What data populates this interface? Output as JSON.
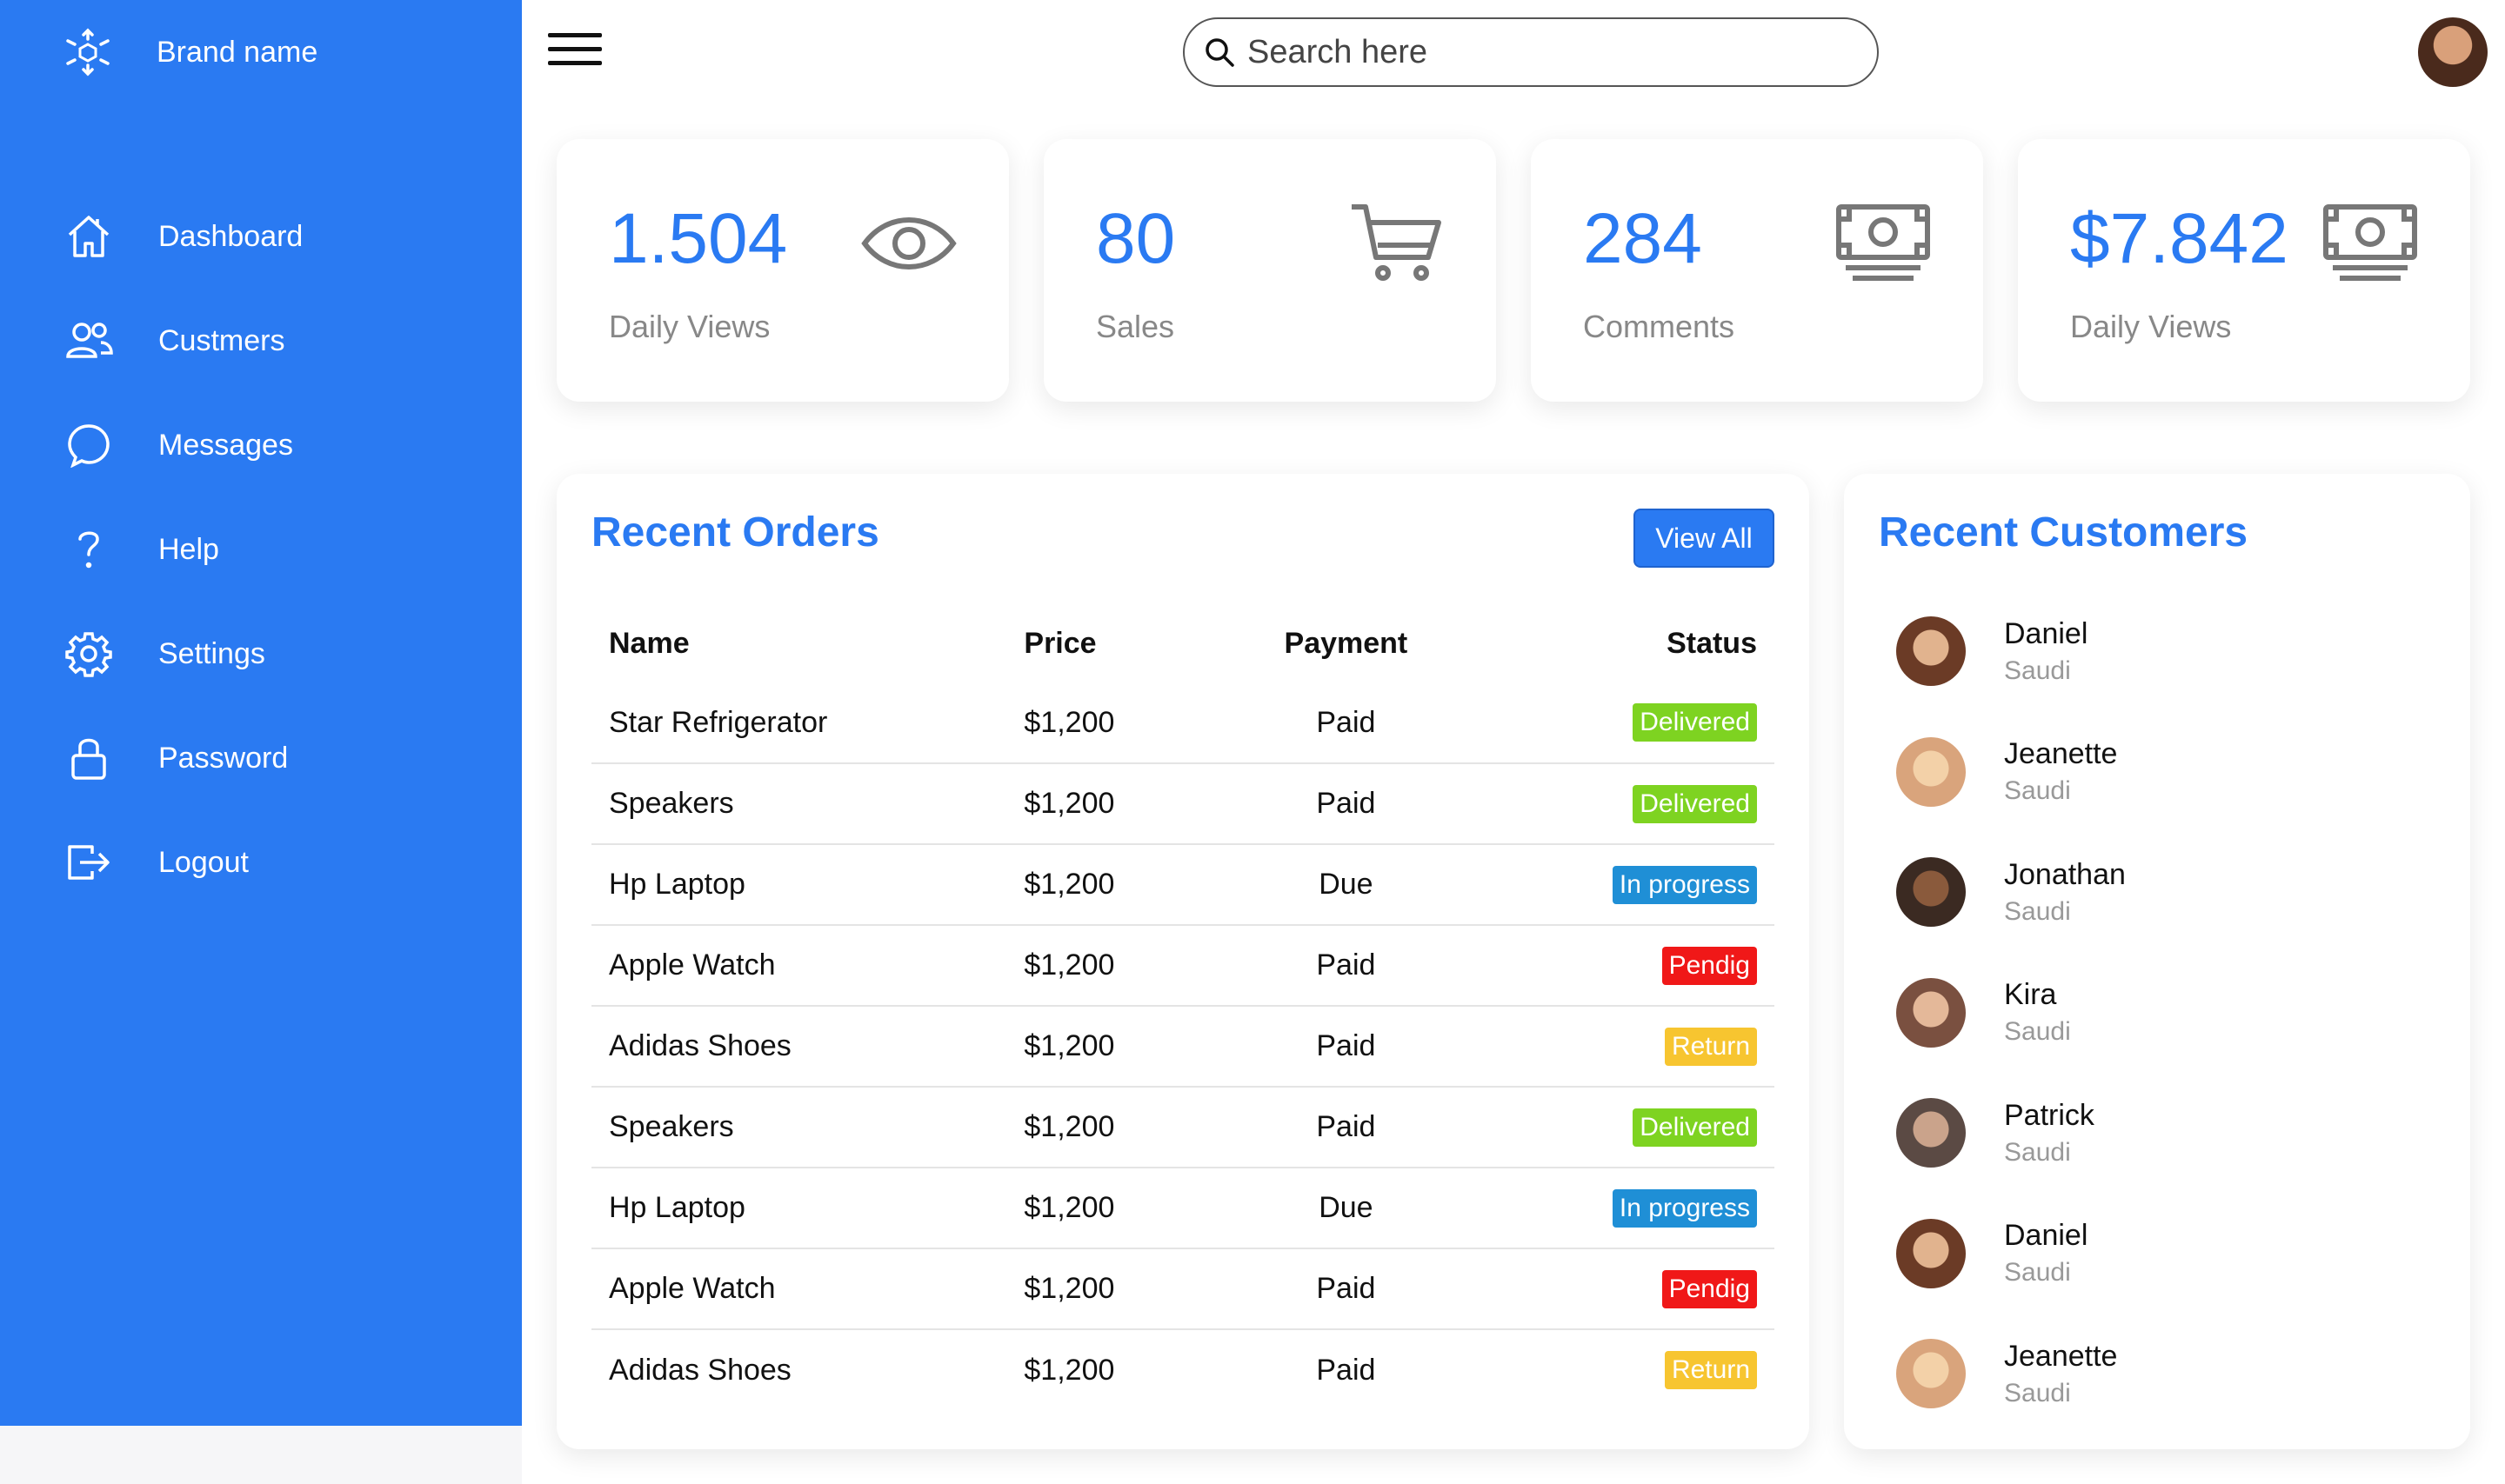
{
  "brand": {
    "name": "Brand name"
  },
  "sidebar": {
    "items": [
      {
        "label": "Dashboard",
        "icon": "home-icon"
      },
      {
        "label": "Custmers",
        "icon": "users-icon"
      },
      {
        "label": "Messages",
        "icon": "chat-icon"
      },
      {
        "label": "Help",
        "icon": "help-icon"
      },
      {
        "label": "Settings",
        "icon": "gear-icon"
      },
      {
        "label": "Password",
        "icon": "lock-icon"
      },
      {
        "label": "Logout",
        "icon": "logout-icon"
      }
    ]
  },
  "search": {
    "placeholder": "Search here"
  },
  "cards": [
    {
      "value": "1.504",
      "label": "Daily Views",
      "icon": "eye-icon"
    },
    {
      "value": "80",
      "label": "Sales",
      "icon": "cart-icon"
    },
    {
      "value": "284",
      "label": "Comments",
      "icon": "money-icon"
    },
    {
      "value": "$7.842",
      "label": "Daily Views",
      "icon": "money-icon"
    }
  ],
  "orders": {
    "title": "Recent Orders",
    "view_all": "View All",
    "columns": {
      "name": "Name",
      "price": "Price",
      "payment": "Payment",
      "status": "Status"
    },
    "rows": [
      {
        "name": "Star Refrigerator",
        "price": "$1,200",
        "payment": "Paid",
        "status": "Delivered"
      },
      {
        "name": "Speakers",
        "price": "$1,200",
        "payment": "Paid",
        "status": "Delivered"
      },
      {
        "name": "Hp Laptop",
        "price": "$1,200",
        "payment": "Due",
        "status": "In progress"
      },
      {
        "name": "Apple Watch",
        "price": "$1,200",
        "payment": "Paid",
        "status": "Pendig"
      },
      {
        "name": "Adidas Shoes",
        "price": "$1,200",
        "payment": "Paid",
        "status": "Return"
      },
      {
        "name": "Speakers",
        "price": "$1,200",
        "payment": "Paid",
        "status": "Delivered"
      },
      {
        "name": "Hp Laptop",
        "price": "$1,200",
        "payment": "Due",
        "status": "In progress"
      },
      {
        "name": "Apple Watch",
        "price": "$1,200",
        "payment": "Paid",
        "status": "Pendig"
      },
      {
        "name": "Adidas Shoes",
        "price": "$1,200",
        "payment": "Paid",
        "status": "Return"
      }
    ]
  },
  "status_colors": {
    "Delivered": "#7ed321",
    "In progress": "#1f8fd6",
    "Pendig": "#f01818",
    "Return": "#f7c530"
  },
  "customers": {
    "title": "Recent Customers",
    "items": [
      {
        "name": "Daniel",
        "location": "Saudi"
      },
      {
        "name": "Jeanette",
        "location": "Saudi"
      },
      {
        "name": "Jonathan",
        "location": "Saudi"
      },
      {
        "name": "Kira",
        "location": "Saudi"
      },
      {
        "name": "Patrick",
        "location": "Saudi"
      },
      {
        "name": "Daniel",
        "location": "Saudi"
      },
      {
        "name": "Jeanette",
        "location": "Saudi"
      }
    ]
  },
  "colors": {
    "accent": "#2a7af2"
  }
}
